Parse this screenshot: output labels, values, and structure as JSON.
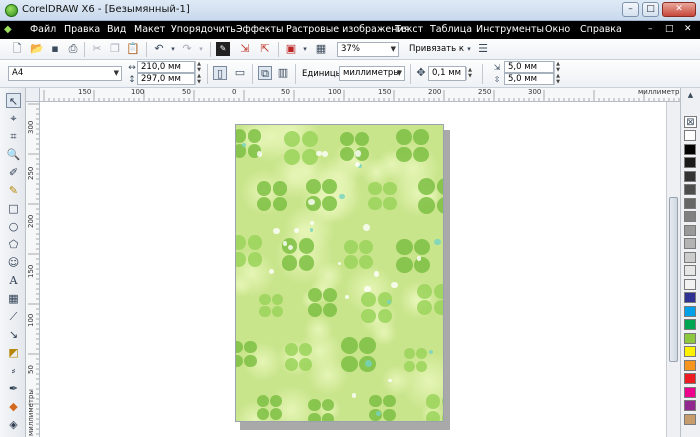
{
  "window": {
    "title": "CorelDRAW X6 - [Безымянный-1]",
    "buttons": {
      "minimize": "–",
      "maximize": "□",
      "close": "✕"
    }
  },
  "menu": {
    "items": [
      "Файл",
      "Правка",
      "Вид",
      "Макет",
      "Упорядочить",
      "Эффекты",
      "Растровые изображения",
      "Текст",
      "Таблица",
      "Инструменты",
      "Окно",
      "Справка"
    ],
    "doc_controls": [
      "–",
      "□",
      "✕"
    ]
  },
  "toolbar1": {
    "zoom_value": "37%",
    "snap_label": "Привязать к"
  },
  "toolbar2": {
    "page_size": "A4",
    "width": "210,0 мм",
    "height": "297,0 мм",
    "units_label": "Единицы:",
    "units_value": "миллиметры",
    "nudge": "0,1 мм",
    "dup_x": "5,0 мм",
    "dup_y": "5,0 мм"
  },
  "rulers": {
    "h_labels": [
      "150",
      "100",
      "50",
      "0",
      "50",
      "100",
      "150",
      "200",
      "250",
      "300"
    ],
    "h_unit": "миллиметры",
    "v_labels": [
      "300",
      "250",
      "200",
      "150",
      "100",
      "50"
    ],
    "v_unit": "миллиметры"
  },
  "icons": {
    "app": "coreldraw-icon",
    "tools": [
      "pick-tool-icon",
      "shape-tool-icon",
      "crop-tool-icon",
      "zoom-tool-icon",
      "freehand-tool-icon",
      "smart-fill-icon",
      "rectangle-tool-icon",
      "ellipse-tool-icon",
      "polygon-tool-icon",
      "basic-shapes-icon",
      "text-tool-icon",
      "table-tool-icon",
      "dimension-tool-icon",
      "connector-tool-icon",
      "blend-tool-icon",
      "eyedropper-tool-icon",
      "outline-tool-icon",
      "fill-tool-icon",
      "interactive-fill-icon"
    ]
  },
  "palette_colors": [
    "#ffffff",
    "#000000",
    "#1a1a1a",
    "#333333",
    "#4d4d4d",
    "#666666",
    "#808080",
    "#999999",
    "#b3b3b3",
    "#cccccc",
    "#e6e6e6",
    "#f2f2f2",
    "#2e3192",
    "#00a0e9",
    "#00a651",
    "#8dc63f",
    "#fff200",
    "#f7941d",
    "#ed1c24",
    "#ec008c",
    "#92278f",
    "#c69c6d"
  ],
  "page_colors": {
    "base": "#c9e58c",
    "leaf_dark": "#7cc043",
    "leaf_mid": "#9ad45a",
    "leaf_light": "#e6f5b6",
    "accent": "#74d3c2"
  }
}
